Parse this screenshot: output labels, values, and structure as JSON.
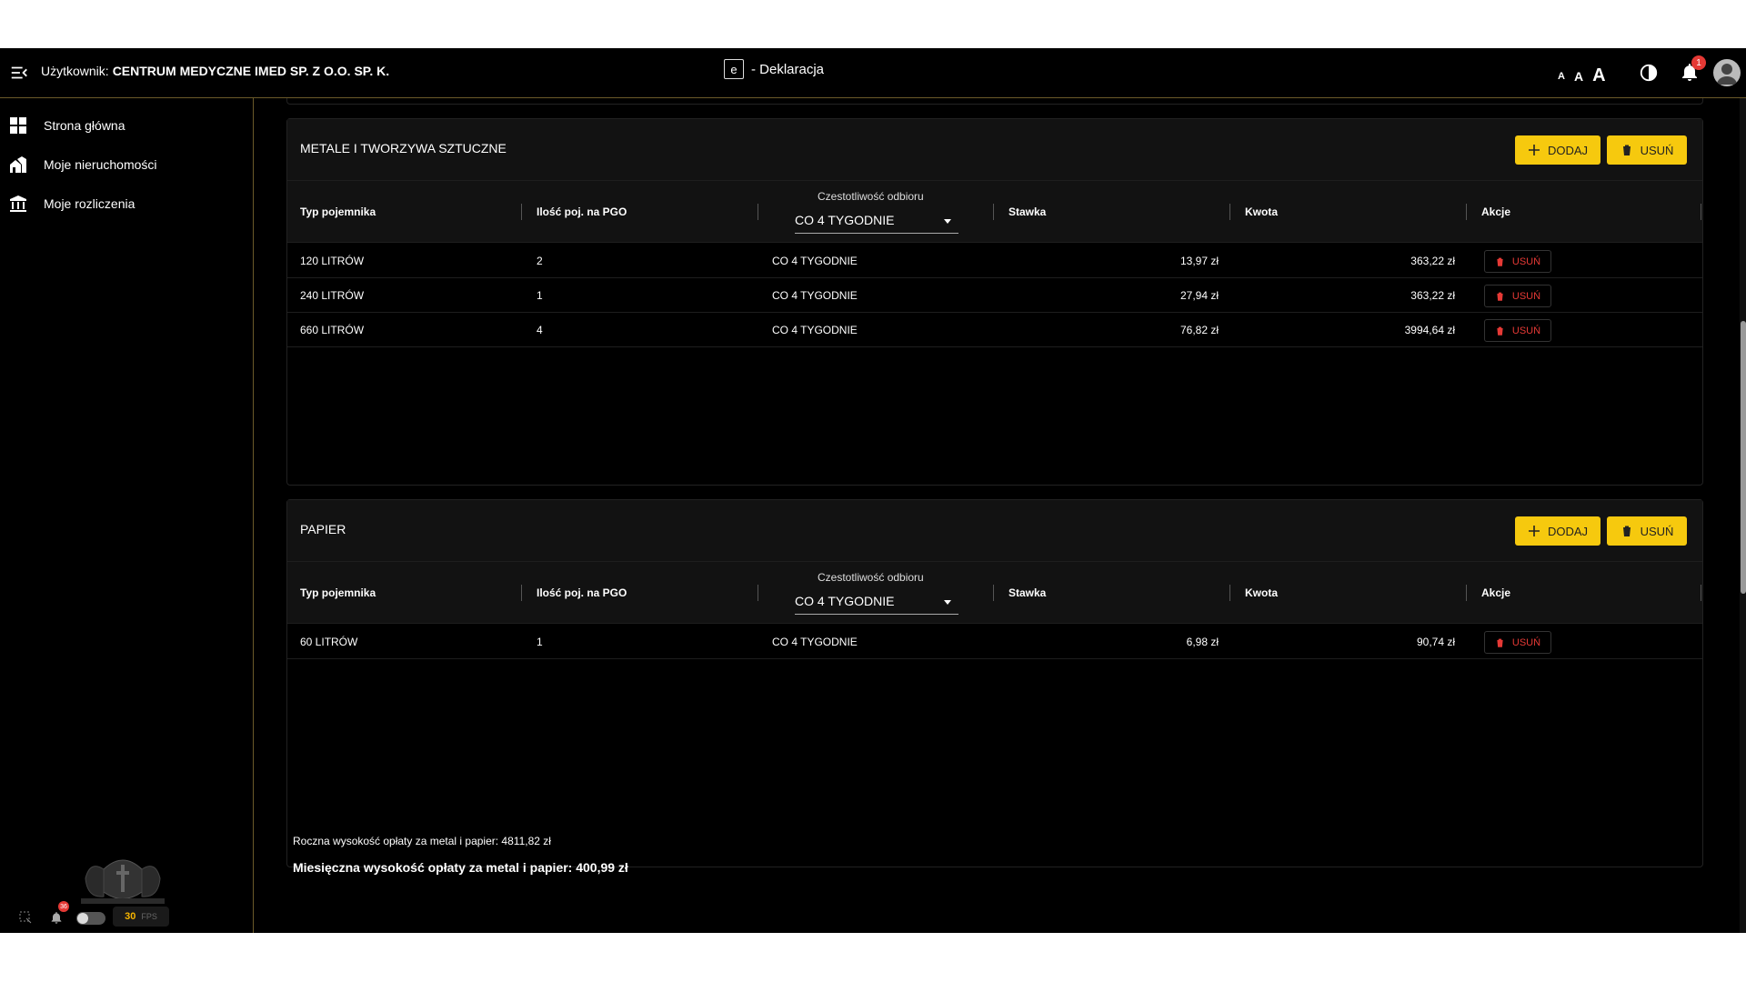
{
  "header": {
    "user_prefix": "Użytkownik:",
    "user_name": "CENTRUM MEDYCZNE IMED SP. Z O.O. SP. K.",
    "app_badge": "e",
    "app_title": "- Deklaracja",
    "font_sizes": [
      "A",
      "A",
      "A"
    ],
    "notifications_count": "1"
  },
  "sidebar": {
    "items": [
      {
        "label": "Strona główna",
        "icon": "dashboard-icon"
      },
      {
        "label": "Moje nieruchomości",
        "icon": "properties-icon"
      },
      {
        "label": "Moje rozliczenia",
        "icon": "bank-icon"
      }
    ],
    "footer": {
      "notif_badge": "36",
      "fps_value": "30",
      "fps_unit": "FPS"
    }
  },
  "columns": {
    "type": "Typ pojemnika",
    "count": "Ilość poj. na PGO",
    "freq": "Czestotliwość odbioru",
    "rate": "Stawka",
    "amount": "Kwota",
    "actions": "Akcje"
  },
  "labels": {
    "add": "DODAJ",
    "remove": "USUŃ",
    "row_remove": "USUŃ"
  },
  "sections": [
    {
      "title": "METALE I TWORZYWA SZTUCZNE",
      "freq_selected": "CO 4 TYGODNIE",
      "rows": [
        {
          "type": "120 LITRÓW",
          "count": "2",
          "freq": "CO 4 TYGODNIE",
          "rate": "13,97 zł",
          "amount": "363,22 zł"
        },
        {
          "type": "240 LITRÓW",
          "count": "1",
          "freq": "CO 4 TYGODNIE",
          "rate": "27,94 zł",
          "amount": "363,22 zł"
        },
        {
          "type": "660 LITRÓW",
          "count": "4",
          "freq": "CO 4 TYGODNIE",
          "rate": "76,82 zł",
          "amount": "3994,64 zł"
        }
      ]
    },
    {
      "title": "PAPIER",
      "freq_selected": "CO 4 TYGODNIE",
      "rows": [
        {
          "type": "60 LITRÓW",
          "count": "1",
          "freq": "CO 4 TYGODNIE",
          "rate": "6,98 zł",
          "amount": "90,74 zł"
        }
      ]
    }
  ],
  "summary": {
    "yearly": "Roczna wysokość opłaty za metal i papier: 4811,82 zł",
    "monthly": "Miesięczna wysokość opłaty za metal i papier: 400,99 zł"
  },
  "colors": {
    "accent": "#f6c90e",
    "danger": "#e53935",
    "border_gold": "#6b5a2a"
  }
}
